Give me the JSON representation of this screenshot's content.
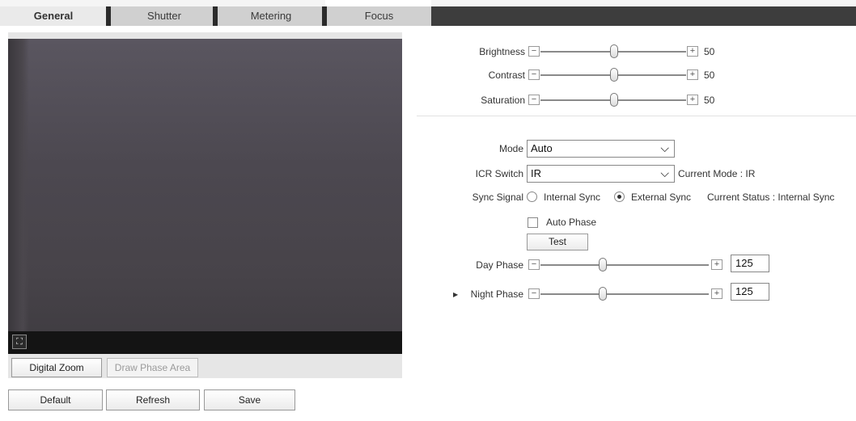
{
  "tabs": [
    {
      "label": "General",
      "active": true
    },
    {
      "label": "Shutter",
      "active": false
    },
    {
      "label": "Metering",
      "active": false
    },
    {
      "label": "Focus",
      "active": false
    }
  ],
  "video": {
    "fullscreen_icon": "fullscreen-icon",
    "digital_zoom_label": "Digital Zoom",
    "draw_phase_area_label": "Draw Phase Area"
  },
  "image_sliders": [
    {
      "label": "Brightness",
      "value": "50",
      "fraction": 0.5
    },
    {
      "label": "Contrast",
      "value": "50",
      "fraction": 0.5
    },
    {
      "label": "Saturation",
      "value": "50",
      "fraction": 0.5
    }
  ],
  "mode": {
    "label": "Mode",
    "value": "Auto"
  },
  "icr": {
    "label": "ICR Switch",
    "value": "IR",
    "current_mode": "Current Mode : IR"
  },
  "sync": {
    "label": "Sync Signal",
    "internal_label": "Internal Sync",
    "external_label": "External Sync",
    "selected": "External Sync",
    "status": "Current Status : Internal Sync"
  },
  "auto_phase": {
    "label": "Auto Phase",
    "checked": false
  },
  "test_label": "Test",
  "day_phase": {
    "label": "Day Phase",
    "value": "125"
  },
  "night_phase": {
    "label": "Night Phase",
    "value": "125"
  },
  "footer": {
    "default_label": "Default",
    "refresh_label": "Refresh",
    "save_label": "Save"
  },
  "colors": {
    "tab_bar_dark": "#3d3d3d",
    "tab_inactive": "#d0d0d0",
    "tab_active": "#eaeaea"
  }
}
